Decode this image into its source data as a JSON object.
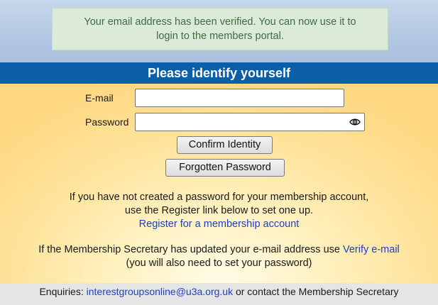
{
  "notice": {
    "line1": "Your email address has been verified. You can now use it to",
    "line2": "login to the members portal."
  },
  "header": {
    "title": "Please identify yourself"
  },
  "form": {
    "email_label": "E-mail",
    "email_value": "",
    "password_label": "Password",
    "password_value": "",
    "confirm_button": "Confirm Identity",
    "forgot_button": "Forgotten Password"
  },
  "register": {
    "line1": "If you have not created a password for your membership account,",
    "line2": "use the Register link below to set one up.",
    "link": "Register for a membership account"
  },
  "verify": {
    "text": "If the Membership Secretary has updated your e-mail address use ",
    "link": "Verify e-mail",
    "line2": "(you will also need to set your password)"
  },
  "footer": {
    "prefix": "Enquiries: ",
    "email": "interestgroupsonline@u3a.org.uk",
    "suffix": " or contact the Membership Secretary"
  },
  "colors": {
    "header_bar": "#0b5ea8",
    "notice_bg": "#dcebd8",
    "link": "#1f3fc7"
  },
  "icons": {
    "password_toggle": "eye-icon"
  }
}
